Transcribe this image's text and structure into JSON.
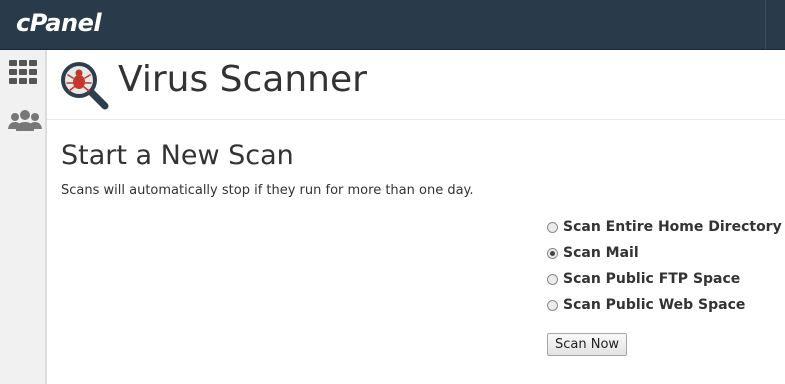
{
  "header": {
    "logo_text": "cPanel",
    "background": "#293a4a"
  },
  "sidebar": {
    "items": [
      {
        "icon": "grid-icon",
        "color": "#555555"
      },
      {
        "icon": "users-icon",
        "color": "#777777"
      }
    ]
  },
  "page": {
    "title": "Virus Scanner",
    "icon": "virus-scanner-icon"
  },
  "scan_section": {
    "heading": "Start a New Scan",
    "description": "Scans will automatically stop if they run for more than one day.",
    "options": [
      {
        "label": "Scan Entire Home Directory",
        "checked": false
      },
      {
        "label": "Scan Mail",
        "checked": true
      },
      {
        "label": "Scan Public FTP Space",
        "checked": false
      },
      {
        "label": "Scan Public Web Space",
        "checked": false
      }
    ],
    "button_label": "Scan Now"
  }
}
